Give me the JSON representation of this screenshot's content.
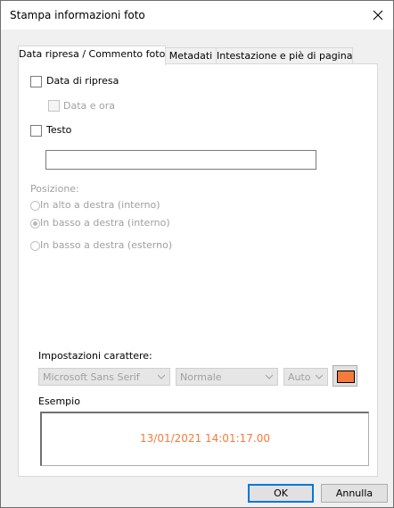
{
  "window": {
    "title": "Stampa informazioni foto"
  },
  "tabs": [
    {
      "label": "Data ripresa / Commento foto",
      "active": true
    },
    {
      "label": "Metadati",
      "active": false
    },
    {
      "label": "Intestazione e piè di pagina",
      "active": false
    }
  ],
  "data_ripresa": {
    "label": "Data di ripresa",
    "checked": false
  },
  "data_ora": {
    "label": "Data e ora",
    "checked": false,
    "enabled": false
  },
  "testo": {
    "label": "Testo",
    "checked": false,
    "value": ""
  },
  "posizione": {
    "label": "Posizione:",
    "options": [
      {
        "label": "In alto a destra (interno)",
        "selected": false
      },
      {
        "label": "In basso a destra (interno)",
        "selected": true
      },
      {
        "label": "In basso a destra (esterno)",
        "selected": false
      }
    ]
  },
  "font_settings": {
    "label": "Impostazioni carattere:",
    "font": "Microsoft Sans Serif",
    "style": "Normale",
    "size": "Auto",
    "color": "#f47b3c"
  },
  "example": {
    "label": "Esempio",
    "text": "13/01/2021 14:01:17.00",
    "color": "#f47b3c"
  },
  "buttons": {
    "ok": "OK",
    "cancel": "Annulla"
  },
  "icons": {
    "close": "close-icon",
    "dropdown": "chevron-down-icon"
  }
}
